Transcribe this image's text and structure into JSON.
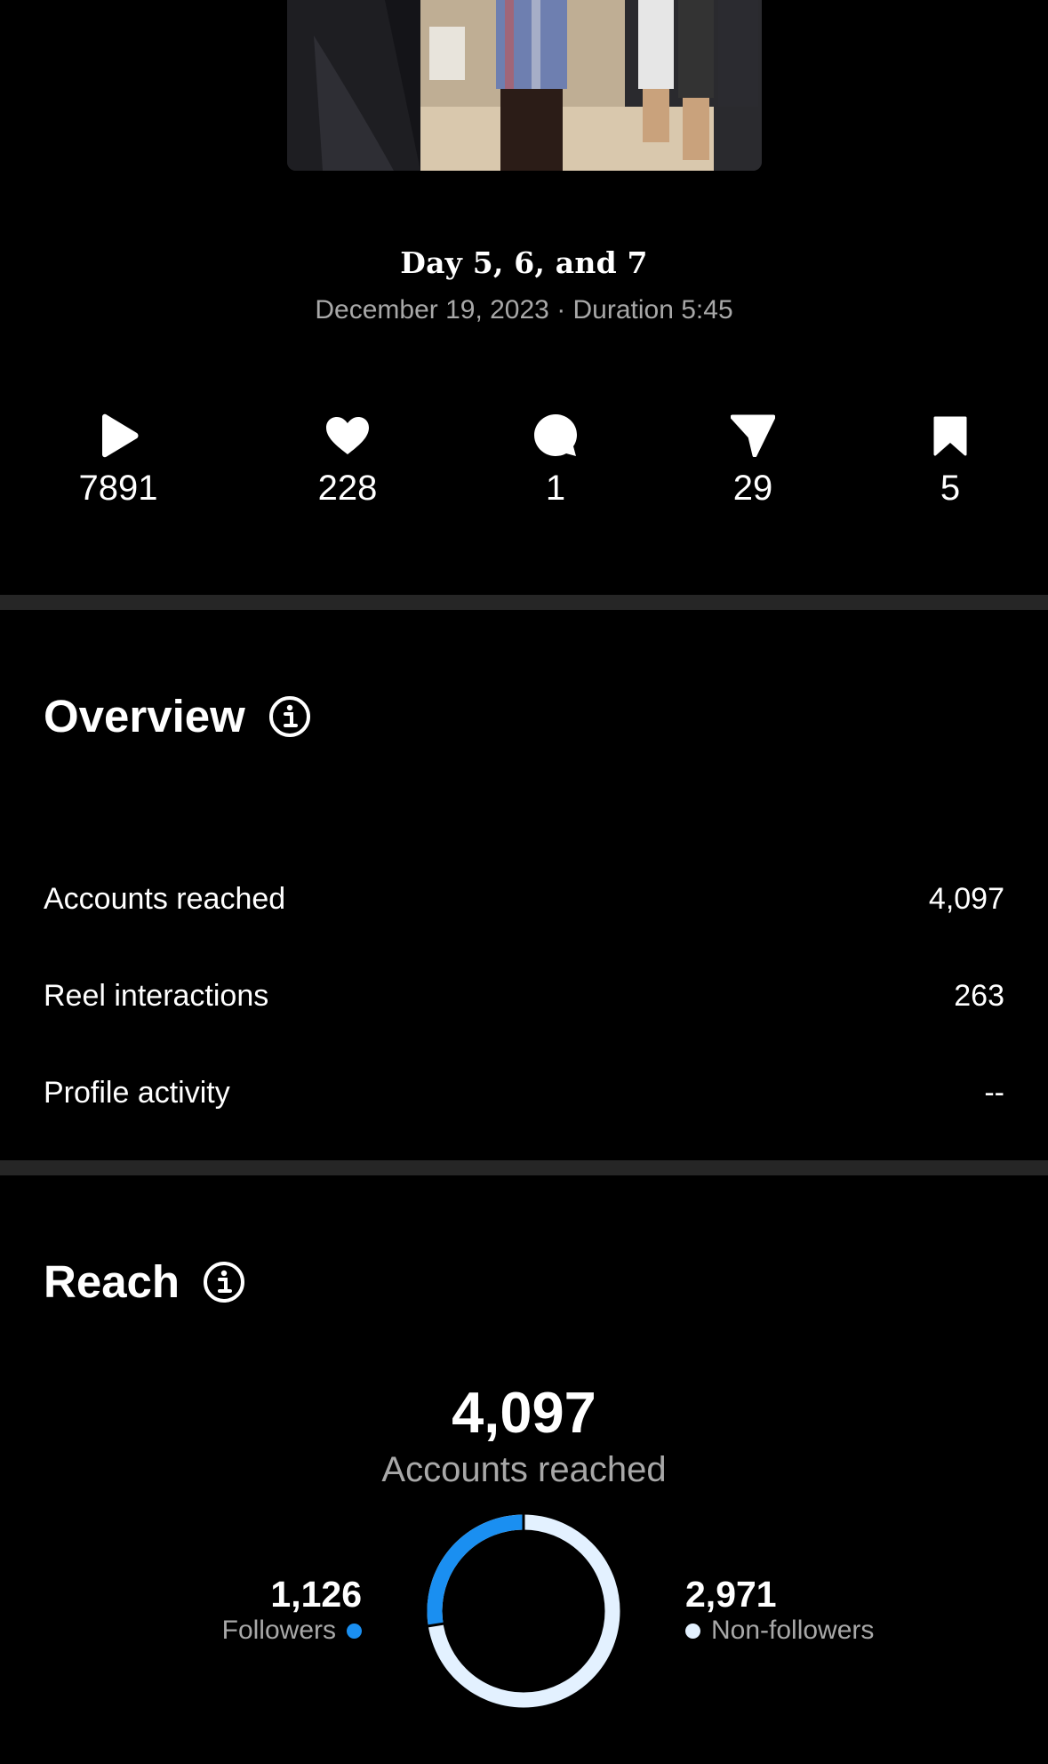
{
  "reel": {
    "title": "Day 5, 6, and 7",
    "subtitle": "December 19, 2023 · Duration 5:45"
  },
  "stats": [
    {
      "icon": "play-icon",
      "value": "7891"
    },
    {
      "icon": "heart-icon",
      "value": "228"
    },
    {
      "icon": "comment-icon",
      "value": "1"
    },
    {
      "icon": "share-icon",
      "value": "29"
    },
    {
      "icon": "bookmark-icon",
      "value": "5"
    }
  ],
  "overview": {
    "title": "Overview",
    "rows": [
      {
        "label": "Accounts reached",
        "value": "4,097"
      },
      {
        "label": "Reel interactions",
        "value": "263"
      },
      {
        "label": "Profile activity",
        "value": "--"
      }
    ]
  },
  "reach": {
    "title": "Reach",
    "total": "4,097",
    "total_label": "Accounts reached",
    "followers": {
      "value": "1,126",
      "label": "Followers",
      "color": "#1a8ff1"
    },
    "non_followers": {
      "value": "2,971",
      "label": "Non-followers",
      "color": "#e3f1ff"
    },
    "followers_fraction": 0.2748
  },
  "colors": {
    "background": "#000000",
    "divider": "#262626",
    "secondary_text": "#a8a8a8"
  }
}
